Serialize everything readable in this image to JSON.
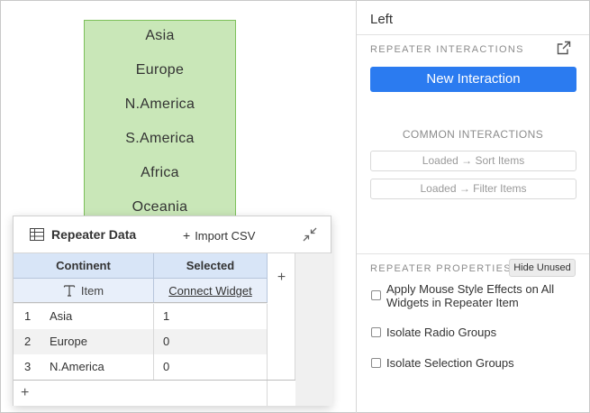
{
  "canvas": {
    "repeater_items": [
      "Asia",
      "Europe",
      "N.America",
      "S.America",
      "Africa",
      "Oceania"
    ]
  },
  "repeater_data": {
    "title": "Repeater Data",
    "import_label": "Import CSV",
    "import_plus": "+",
    "columns": [
      {
        "header": "Continent",
        "subheader": "Item",
        "subheader_icon": "text-type-icon"
      },
      {
        "header": "Selected",
        "subheader": "Connect Widget"
      }
    ],
    "add_column_label": "+",
    "add_row_label": "+",
    "rows": [
      {
        "num": "1",
        "continent": "Asia",
        "selected": "1"
      },
      {
        "num": "2",
        "continent": "Europe",
        "selected": "0"
      },
      {
        "num": "3",
        "continent": "N.America",
        "selected": "0"
      }
    ]
  },
  "panel": {
    "title": "Left",
    "interactions_label": "REPEATER INTERACTIONS",
    "new_interaction": "New Interaction",
    "common_label": "COMMON INTERACTIONS",
    "common_buttons": [
      "Loaded → Sort Items",
      "Loaded → Filter Items"
    ],
    "properties_label": "REPEATER PROPERTIES",
    "hide_unused": "Hide Unused",
    "checkboxes": [
      {
        "label_line1": "Apply Mouse Style Effects on All",
        "label_line2": "Widgets in Repeater Item",
        "checked": false
      },
      {
        "label_line1": "Isolate Radio Groups",
        "checked": false
      },
      {
        "label_line1": "Isolate Selection Groups",
        "checked": false
      }
    ]
  },
  "colors": {
    "repeater_fill": "#c9e7b8",
    "repeater_border": "#7cc05a",
    "primary": "#2b7bf0",
    "header_fill": "#d8e5f7"
  }
}
